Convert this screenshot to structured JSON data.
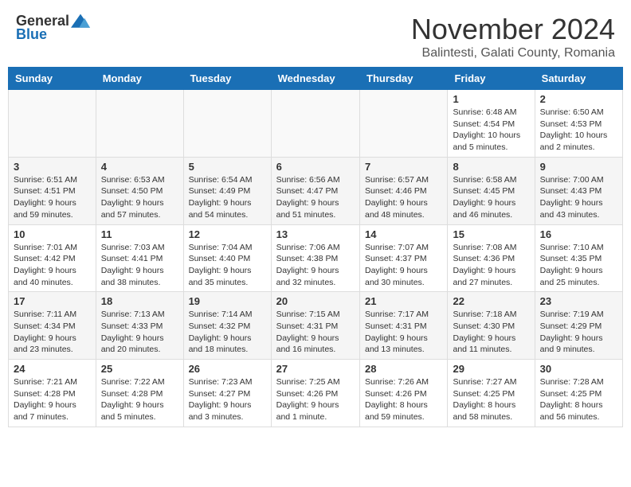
{
  "header": {
    "logo_general": "General",
    "logo_blue": "Blue",
    "month_year": "November 2024",
    "location": "Balintesti, Galati County, Romania"
  },
  "weekdays": [
    "Sunday",
    "Monday",
    "Tuesday",
    "Wednesday",
    "Thursday",
    "Friday",
    "Saturday"
  ],
  "weeks": [
    [
      {
        "day": "",
        "info": ""
      },
      {
        "day": "",
        "info": ""
      },
      {
        "day": "",
        "info": ""
      },
      {
        "day": "",
        "info": ""
      },
      {
        "day": "",
        "info": ""
      },
      {
        "day": "1",
        "info": "Sunrise: 6:48 AM\nSunset: 4:54 PM\nDaylight: 10 hours and 5 minutes."
      },
      {
        "day": "2",
        "info": "Sunrise: 6:50 AM\nSunset: 4:53 PM\nDaylight: 10 hours and 2 minutes."
      }
    ],
    [
      {
        "day": "3",
        "info": "Sunrise: 6:51 AM\nSunset: 4:51 PM\nDaylight: 9 hours and 59 minutes."
      },
      {
        "day": "4",
        "info": "Sunrise: 6:53 AM\nSunset: 4:50 PM\nDaylight: 9 hours and 57 minutes."
      },
      {
        "day": "5",
        "info": "Sunrise: 6:54 AM\nSunset: 4:49 PM\nDaylight: 9 hours and 54 minutes."
      },
      {
        "day": "6",
        "info": "Sunrise: 6:56 AM\nSunset: 4:47 PM\nDaylight: 9 hours and 51 minutes."
      },
      {
        "day": "7",
        "info": "Sunrise: 6:57 AM\nSunset: 4:46 PM\nDaylight: 9 hours and 48 minutes."
      },
      {
        "day": "8",
        "info": "Sunrise: 6:58 AM\nSunset: 4:45 PM\nDaylight: 9 hours and 46 minutes."
      },
      {
        "day": "9",
        "info": "Sunrise: 7:00 AM\nSunset: 4:43 PM\nDaylight: 9 hours and 43 minutes."
      }
    ],
    [
      {
        "day": "10",
        "info": "Sunrise: 7:01 AM\nSunset: 4:42 PM\nDaylight: 9 hours and 40 minutes."
      },
      {
        "day": "11",
        "info": "Sunrise: 7:03 AM\nSunset: 4:41 PM\nDaylight: 9 hours and 38 minutes."
      },
      {
        "day": "12",
        "info": "Sunrise: 7:04 AM\nSunset: 4:40 PM\nDaylight: 9 hours and 35 minutes."
      },
      {
        "day": "13",
        "info": "Sunrise: 7:06 AM\nSunset: 4:38 PM\nDaylight: 9 hours and 32 minutes."
      },
      {
        "day": "14",
        "info": "Sunrise: 7:07 AM\nSunset: 4:37 PM\nDaylight: 9 hours and 30 minutes."
      },
      {
        "day": "15",
        "info": "Sunrise: 7:08 AM\nSunset: 4:36 PM\nDaylight: 9 hours and 27 minutes."
      },
      {
        "day": "16",
        "info": "Sunrise: 7:10 AM\nSunset: 4:35 PM\nDaylight: 9 hours and 25 minutes."
      }
    ],
    [
      {
        "day": "17",
        "info": "Sunrise: 7:11 AM\nSunset: 4:34 PM\nDaylight: 9 hours and 23 minutes."
      },
      {
        "day": "18",
        "info": "Sunrise: 7:13 AM\nSunset: 4:33 PM\nDaylight: 9 hours and 20 minutes."
      },
      {
        "day": "19",
        "info": "Sunrise: 7:14 AM\nSunset: 4:32 PM\nDaylight: 9 hours and 18 minutes."
      },
      {
        "day": "20",
        "info": "Sunrise: 7:15 AM\nSunset: 4:31 PM\nDaylight: 9 hours and 16 minutes."
      },
      {
        "day": "21",
        "info": "Sunrise: 7:17 AM\nSunset: 4:31 PM\nDaylight: 9 hours and 13 minutes."
      },
      {
        "day": "22",
        "info": "Sunrise: 7:18 AM\nSunset: 4:30 PM\nDaylight: 9 hours and 11 minutes."
      },
      {
        "day": "23",
        "info": "Sunrise: 7:19 AM\nSunset: 4:29 PM\nDaylight: 9 hours and 9 minutes."
      }
    ],
    [
      {
        "day": "24",
        "info": "Sunrise: 7:21 AM\nSunset: 4:28 PM\nDaylight: 9 hours and 7 minutes."
      },
      {
        "day": "25",
        "info": "Sunrise: 7:22 AM\nSunset: 4:28 PM\nDaylight: 9 hours and 5 minutes."
      },
      {
        "day": "26",
        "info": "Sunrise: 7:23 AM\nSunset: 4:27 PM\nDaylight: 9 hours and 3 minutes."
      },
      {
        "day": "27",
        "info": "Sunrise: 7:25 AM\nSunset: 4:26 PM\nDaylight: 9 hours and 1 minute."
      },
      {
        "day": "28",
        "info": "Sunrise: 7:26 AM\nSunset: 4:26 PM\nDaylight: 8 hours and 59 minutes."
      },
      {
        "day": "29",
        "info": "Sunrise: 7:27 AM\nSunset: 4:25 PM\nDaylight: 8 hours and 58 minutes."
      },
      {
        "day": "30",
        "info": "Sunrise: 7:28 AM\nSunset: 4:25 PM\nDaylight: 8 hours and 56 minutes."
      }
    ]
  ]
}
